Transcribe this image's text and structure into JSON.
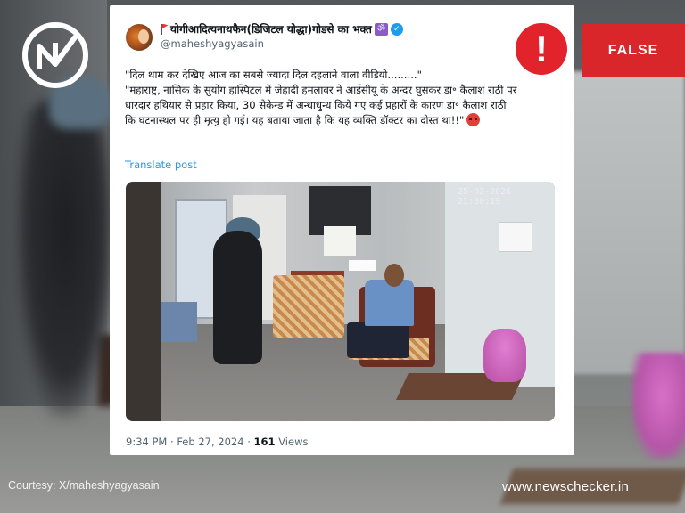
{
  "badge": {
    "label": "FALSE",
    "color": "#d9262b"
  },
  "tweet": {
    "display_name": "योगीआदित्यनाथफैन(डिजिटल योद्धा)गोडसे का भक्त",
    "handle": "@maheshyagyasain",
    "line1": "\"दिल थाम कर देखिए आज का सबसे ज्यादा दिल दहलाने वाला वीडियो.........\"",
    "line2": "\"महाराष्ट्र, नासिक के सुयोग हास्पिटल में जेहादी हमलावर ने आईसीयू के अन्दर घुसकर डा॰ कैलाश राठी पर धारदार हथियार से प्रहार किया, 30 सेकेन्ड में अन्धाधुन्ध किये गए कई प्रहारों के कारण डा॰ कैलाश राठी कि घटनास्थल पर ही मृत्यु हो गई। यह बताया जाता है कि यह व्यक्ति डॉक्टर का दोस्त था!!\"",
    "translate_label": "Translate post",
    "time": "9:34 PM",
    "date": "Feb 27, 2024",
    "views_count": "161",
    "views_label": "Views",
    "icons": [
      "flag-icon",
      "om-icon",
      "verified-icon",
      "angry-face-icon"
    ]
  },
  "video": {
    "timestamp": "25-02-2026 21:30:19"
  },
  "footer": {
    "courtesy": "Courtesy: X/maheshyagyasain",
    "site": "www.newschecker.in"
  },
  "colors": {
    "alert": "#e3232b",
    "link": "#1d9bf0",
    "text": "#0f1419",
    "muted": "#536471"
  }
}
